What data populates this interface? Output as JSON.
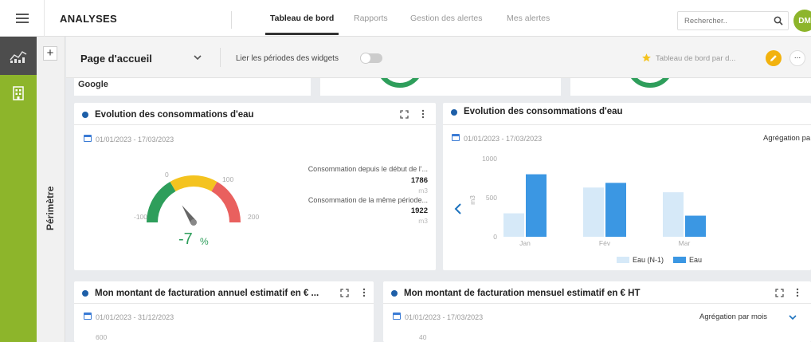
{
  "app": {
    "title": "ANALYSES"
  },
  "nav": {
    "tabs": [
      {
        "label": "Tableau de bord",
        "active": true
      },
      {
        "label": "Rapports"
      },
      {
        "label": "Gestion des alertes"
      },
      {
        "label": "Mes alertes"
      }
    ]
  },
  "search": {
    "placeholder": "Rechercher.."
  },
  "user": {
    "initials": "DM"
  },
  "sidebar": {
    "perimetre_label": "Périmètre",
    "add_label": "+"
  },
  "dashboard": {
    "page_name": "Page d'accueil",
    "link_periods_label": "Lier les périodes des widgets",
    "link_periods_on": false,
    "favorite_label": "Tableau de bord par d...",
    "more_label": "..."
  },
  "partial_widgets": {
    "google_label": "Google"
  },
  "widgets": {
    "gauge": {
      "title": "Evolution des consommations d'eau",
      "date_range": "01/01/2023 - 17/03/2023",
      "ticks": {
        "min": "-100",
        "t0": "0",
        "t100": "100",
        "max": "200"
      },
      "value": "-7",
      "value_number": -7,
      "unit": "%",
      "stat1_label": "Consommation depuis le début de l'...",
      "stat1_value": "1786",
      "stat1_unit": "m3",
      "stat2_label": "Consommation de la même période...",
      "stat2_value": "1922",
      "stat2_unit": "m3",
      "colors": {
        "green": "#2e9e5b",
        "yellow": "#f4c31f",
        "red": "#e9605e"
      }
    },
    "bar": {
      "title": "Evolution des consommations d'eau",
      "date_range": "01/01/2023 - 17/03/2023",
      "aggregation_label": "Agrégation pa",
      "ylabel": "m3"
    },
    "annual": {
      "title": "Mon montant de facturation annuel estimatif en € ...",
      "date_range": "01/01/2023 - 31/12/2023",
      "axis_top": "600"
    },
    "monthly": {
      "title": "Mon montant de facturation mensuel estimatif en € HT",
      "date_range": "01/01/2023 - 17/03/2023",
      "aggregation_label": "Agrégation par mois",
      "axis_top": "40"
    }
  },
  "chart_data": {
    "type": "bar",
    "categories": [
      "Jan",
      "Fév",
      "Mar"
    ],
    "series": [
      {
        "name": "Eau (N-1)",
        "values": [
          300,
          630,
          570
        ],
        "color": "#d6e9f8"
      },
      {
        "name": "Eau",
        "values": [
          800,
          690,
          270
        ],
        "color": "#3b97e3"
      }
    ],
    "ylabel": "m3",
    "ylim": [
      0,
      1000
    ],
    "yticks": [
      "0",
      "500",
      "1000"
    ],
    "legend": "bottom"
  }
}
